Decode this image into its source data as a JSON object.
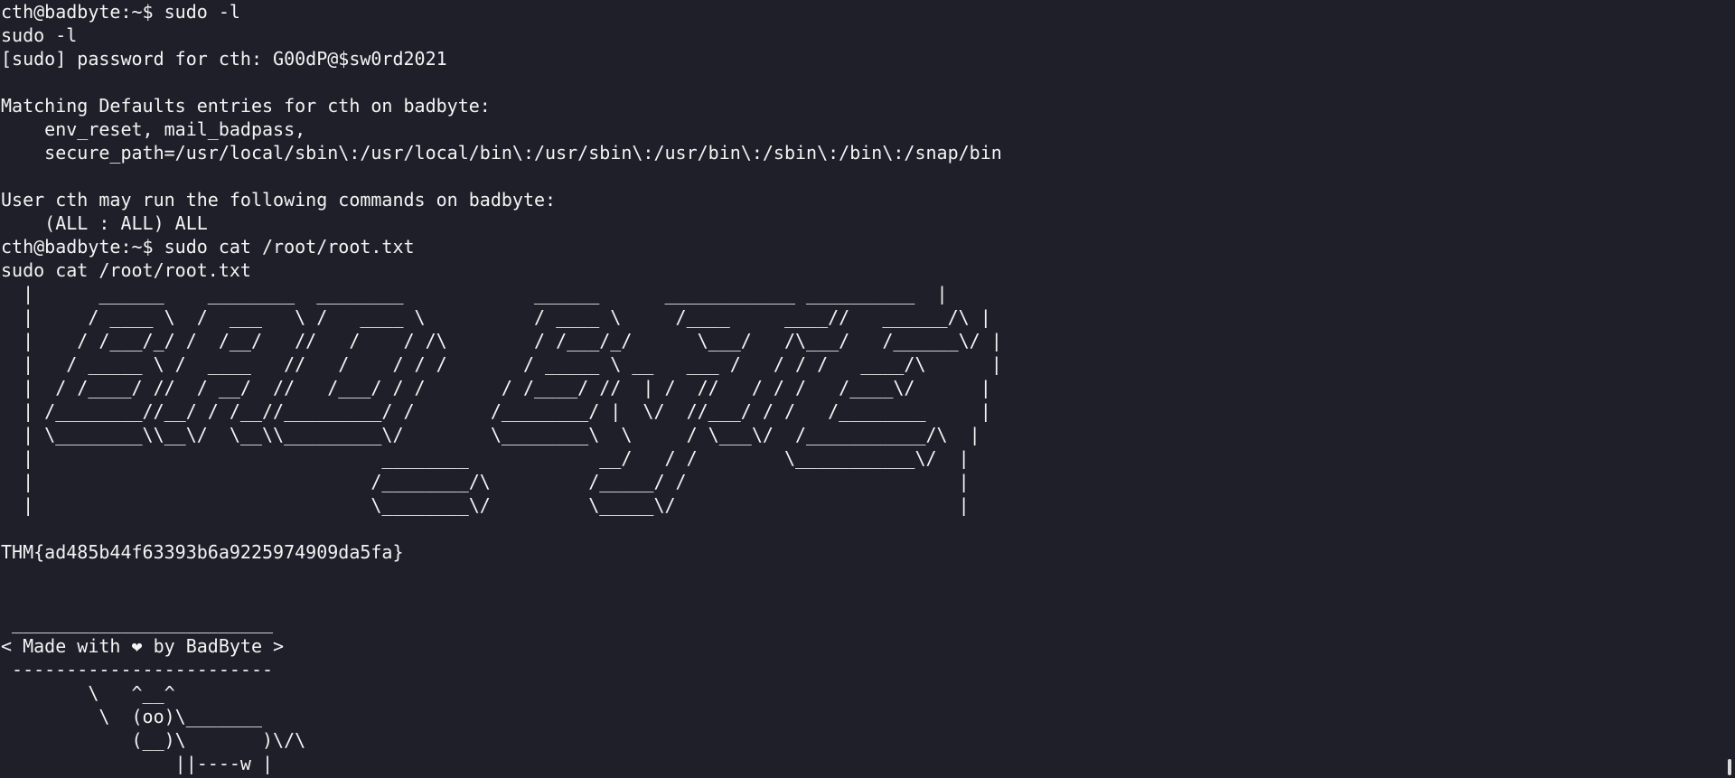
{
  "terminal": {
    "lines": [
      "cth@badbyte:~$ sudo -l",
      "sudo -l",
      "[sudo] password for cth: G00dP@$sw0rd2021",
      "",
      "Matching Defaults entries for cth on badbyte:",
      "    env_reset, mail_badpass,",
      "    secure_path=/usr/local/sbin\\:/usr/local/bin\\:/usr/sbin\\:/usr/bin\\:/sbin\\:/bin\\:/snap/bin",
      "",
      "User cth may run the following commands on badbyte:",
      "    (ALL : ALL) ALL",
      "cth@badbyte:~$ sudo cat /root/root.txt",
      "sudo cat /root/root.txt",
      "  |      ______    ________  ________            ______      ____________ __________  |",
      "  |     / ____ \\  /  ___   \\ /   ____ \\          / ____ \\     /____     ____//   ______/\\ |",
      "  |    / /___/_/ /  /__/   //   /    / /\\        / /___/_/      \\___/   /\\___/   /______\\/ |",
      "  |   / _____ \\ /  ____   //   /    / / /       / _____ \\ __   ___ /   / / /   ____/\\      |",
      "  |  / /____/ //  / __/  //   /___/ / /       / /____/ //  | /  //   / / /   /____\\/      |",
      "  | /________//__/ / /__//_________/ /       /________/ |  \\/  //___/ / /   /________     |",
      "  | \\________\\\\__\\/  \\__\\\\_________\\/        \\________\\  \\     / \\___\\/  /___________/\\  |",
      "  |                                ________            __/   / /        \\___________\\/  |",
      "  |                               /________/\\         /_____/ /                         |",
      "  |                               \\________\\/         \\_____\\/                          |",
      "",
      "THM{ad485b44f63393b6a9225974909da5fa}",
      "",
      "",
      " ________________________",
      "< Made with ❤ by BadByte >",
      " ------------------------",
      "        \\   ^__^",
      "         \\  (oo)\\_______",
      "            (__)\\       )\\/\\",
      "                ||----w |",
      "                ||     ||"
    ]
  }
}
